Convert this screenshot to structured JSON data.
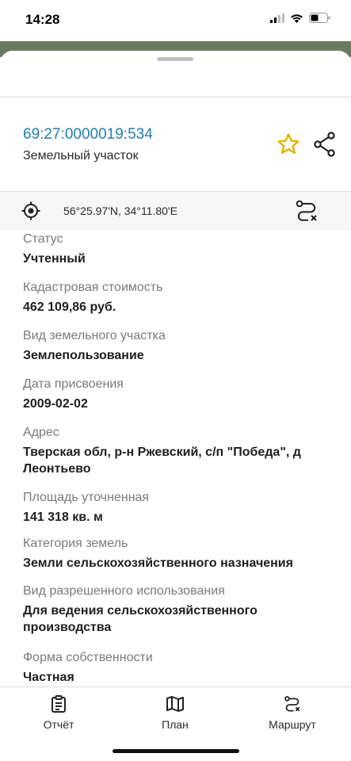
{
  "status_bar": {
    "time": "14:28"
  },
  "header": {
    "cadastral_number": "69:27:0000019:534",
    "object_type": "Земельный участок"
  },
  "coordinates": {
    "text": "56°25.97'N, 34°11.80'E"
  },
  "properties": [
    {
      "label": "Статус",
      "value": "Учтенный"
    },
    {
      "label": "Кадастровая стоимость",
      "value": "462 109,86 руб."
    },
    {
      "label": "Вид земельного участка",
      "value": "Землепользование"
    },
    {
      "label": "Дата присвоения",
      "value": "2009-02-02"
    },
    {
      "label": "Адрес",
      "value": "Тверская обл, р-н Ржевский, с/п \"Победа\", д Леонтьево"
    },
    {
      "label": "Площадь уточненная",
      "value": "141 318 кв. м"
    },
    {
      "label": "Категория земель",
      "value": "Земли сельскохозяйственного назначения"
    },
    {
      "label": "Вид разрешенного использования",
      "value": "Для ведения сельскохозяйственного производства"
    },
    {
      "label": "Форма собственности",
      "value": "Частная"
    }
  ],
  "tabs": [
    {
      "label": "Отчёт",
      "icon": "report-icon"
    },
    {
      "label": "План",
      "icon": "map-icon"
    },
    {
      "label": "Маршрут",
      "icon": "route-icon"
    }
  ],
  "colors": {
    "link": "#1f7fb0",
    "star": "#e2b400"
  }
}
